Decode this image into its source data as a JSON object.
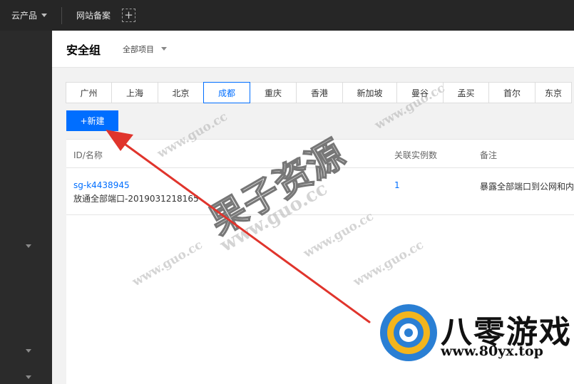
{
  "topbar": {
    "products_label": "云产品",
    "record_label": "网站备案",
    "plus_glyph": "+"
  },
  "header": {
    "title": "安全组",
    "project_label": "全部项目"
  },
  "regions": [
    {
      "label": "广州",
      "width": 65
    },
    {
      "label": "上海",
      "width": 66
    },
    {
      "label": "北京",
      "width": 65
    },
    {
      "label": "成都",
      "width": 66,
      "active": true
    },
    {
      "label": "重庆",
      "width": 66
    },
    {
      "label": "香港",
      "width": 66
    },
    {
      "label": "新加坡",
      "width": 77
    },
    {
      "label": "曼谷",
      "width": 66
    },
    {
      "label": "孟买",
      "width": 65
    },
    {
      "label": "首尔",
      "width": 66
    },
    {
      "label": "东京",
      "width": 52
    }
  ],
  "toolbar": {
    "new_label": "+新建"
  },
  "table": {
    "columns": {
      "id_name": "ID/名称",
      "instance_count": "关联实例数",
      "note": "备注"
    },
    "rows": [
      {
        "id": "sg-k4438945",
        "name": "放通全部端口-2019031218165",
        "count": "1",
        "note": "暴露全部端口到公网和内"
      }
    ]
  },
  "watermarks": {
    "url_text": "www.guo.cc",
    "cn_text": "果子资源"
  },
  "brand": {
    "name": "八零游戏",
    "url": "www.80yx.top"
  },
  "colors": {
    "accent": "#006eff",
    "annotation_arrow": "#e0342c",
    "topbar_bg": "#262626",
    "sidebar_bg": "#2b2b2b"
  }
}
